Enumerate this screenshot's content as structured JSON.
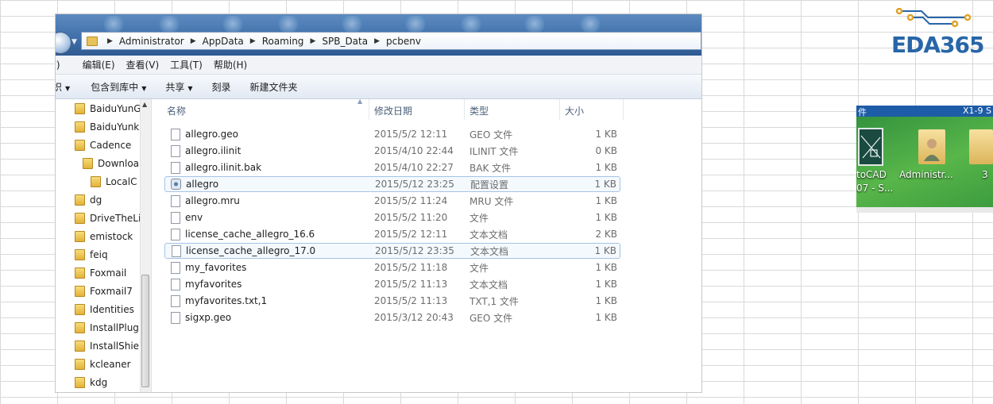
{
  "address": {
    "crumbs": [
      "Administrator",
      "AppData",
      "Roaming",
      "SPB_Data",
      "pcbenv"
    ]
  },
  "menu": [
    "F)",
    "编辑(E)",
    "查看(V)",
    "工具(T)",
    "帮助(H)"
  ],
  "commands": {
    "organize_fragment": "织",
    "include_library": "包含到库中",
    "share": "共享",
    "burn": "刻录",
    "new_folder": "新建文件夹"
  },
  "nav_items": [
    {
      "label": "BaiduYunG"
    },
    {
      "label": "BaiduYunk"
    },
    {
      "label": "Cadence"
    },
    {
      "label": "Downloa"
    },
    {
      "label": "LocalC"
    },
    {
      "label": "dg"
    },
    {
      "label": "DriveTheLi"
    },
    {
      "label": "emistock"
    },
    {
      "label": "feiq"
    },
    {
      "label": "Foxmail"
    },
    {
      "label": "Foxmail7"
    },
    {
      "label": "Identities"
    },
    {
      "label": "InstallPlug"
    },
    {
      "label": "InstallShie"
    },
    {
      "label": "kcleaner"
    },
    {
      "label": "kdg"
    }
  ],
  "columns": {
    "name": "名称",
    "date": "修改日期",
    "type": "类型",
    "size": "大小"
  },
  "files": [
    {
      "name": "allegro.geo",
      "date": "2015/5/2 12:11",
      "type": "GEO 文件",
      "size": "1 KB",
      "icon": "file-icon"
    },
    {
      "name": "allegro.ilinit",
      "date": "2015/4/10 22:44",
      "type": "ILINIT 文件",
      "size": "0 KB",
      "icon": "file-icon"
    },
    {
      "name": "allegro.ilinit.bak",
      "date": "2015/4/10 22:27",
      "type": "BAK 文件",
      "size": "1 KB",
      "icon": "file-icon"
    },
    {
      "name": "allegro",
      "date": "2015/5/12 23:25",
      "type": "配置设置",
      "size": "1 KB",
      "icon": "config-icon"
    },
    {
      "name": "allegro.mru",
      "date": "2015/5/2 11:24",
      "type": "MRU 文件",
      "size": "1 KB",
      "icon": "file-icon"
    },
    {
      "name": "env",
      "date": "2015/5/2 11:20",
      "type": "文件",
      "size": "1 KB",
      "icon": "file-icon"
    },
    {
      "name": "license_cache_allegro_16.6",
      "date": "2015/5/2 12:11",
      "type": "文本文档",
      "size": "2 KB",
      "icon": "file-icon"
    },
    {
      "name": "license_cache_allegro_17.0",
      "date": "2015/5/12 23:35",
      "type": "文本文档",
      "size": "1 KB",
      "icon": "file-icon"
    },
    {
      "name": "my_favorites",
      "date": "2015/5/2 11:18",
      "type": "文件",
      "size": "1 KB",
      "icon": "file-icon"
    },
    {
      "name": "myfavorites",
      "date": "2015/5/2 11:13",
      "type": "文本文档",
      "size": "1 KB",
      "icon": "file-icon"
    },
    {
      "name": "myfavorites.txt,1",
      "date": "2015/5/2 11:13",
      "type": "TXT,1 文件",
      "size": "1 KB",
      "icon": "file-icon"
    },
    {
      "name": "sigxp.geo",
      "date": "2015/3/12 20:43",
      "type": "GEO 文件",
      "size": "1 KB",
      "icon": "file-icon"
    }
  ],
  "logo": {
    "text": "EDA365",
    "color": "#2766a8"
  },
  "desktop": {
    "top_left": "件",
    "top_right": "X1-9 S",
    "icon1_label_line1": "toCAD",
    "icon1_label_line2": "07 - S...",
    "icon2_label": "Administr...",
    "icon3_label": "3"
  },
  "colors": {
    "window_frame": "#3f6ea8",
    "selection_border": "#a4c3e6",
    "desktop_green": "#4aa544"
  }
}
